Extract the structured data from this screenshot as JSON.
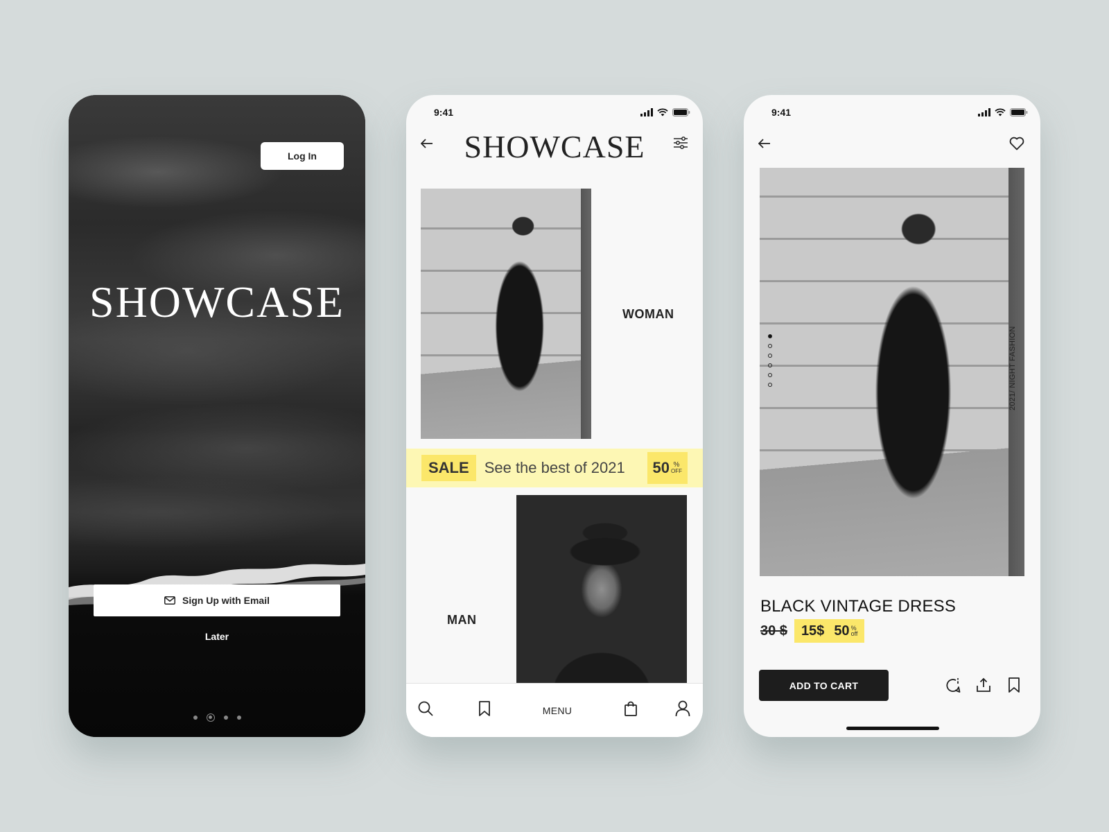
{
  "onboarding": {
    "login_label": "Log In",
    "brand": "SHOWCASE",
    "signup_label": "Sign Up with Email",
    "later_label": "Later",
    "pagination": {
      "count": 4,
      "active": 1
    }
  },
  "status_bar": {
    "time": "9:41"
  },
  "catalog": {
    "brand": "SHOWCASE",
    "categories": [
      {
        "label": "WOMAN"
      },
      {
        "label": "MAN"
      }
    ],
    "sale": {
      "tag": "SALE",
      "text": "See the best of 2021",
      "percent": "50",
      "percent_sign": "%",
      "off": "OFF"
    },
    "tabbar": {
      "menu_label": "MENU"
    }
  },
  "product": {
    "caption": "2021/ NIGHT FASHION",
    "name": "BLACK VINTAGE DRESS",
    "old_price": "30 $",
    "new_price": "15$",
    "discount": "50",
    "discount_sign": "%",
    "discount_off": "off",
    "cart_label": "ADD TO CART",
    "gallery": {
      "count": 6,
      "active": 0
    }
  },
  "colors": {
    "background": "#d5dbdb",
    "accent_yellow": "#fbe76a",
    "sale_bar": "#fdf7b4",
    "dark": "#1d1d1d"
  }
}
